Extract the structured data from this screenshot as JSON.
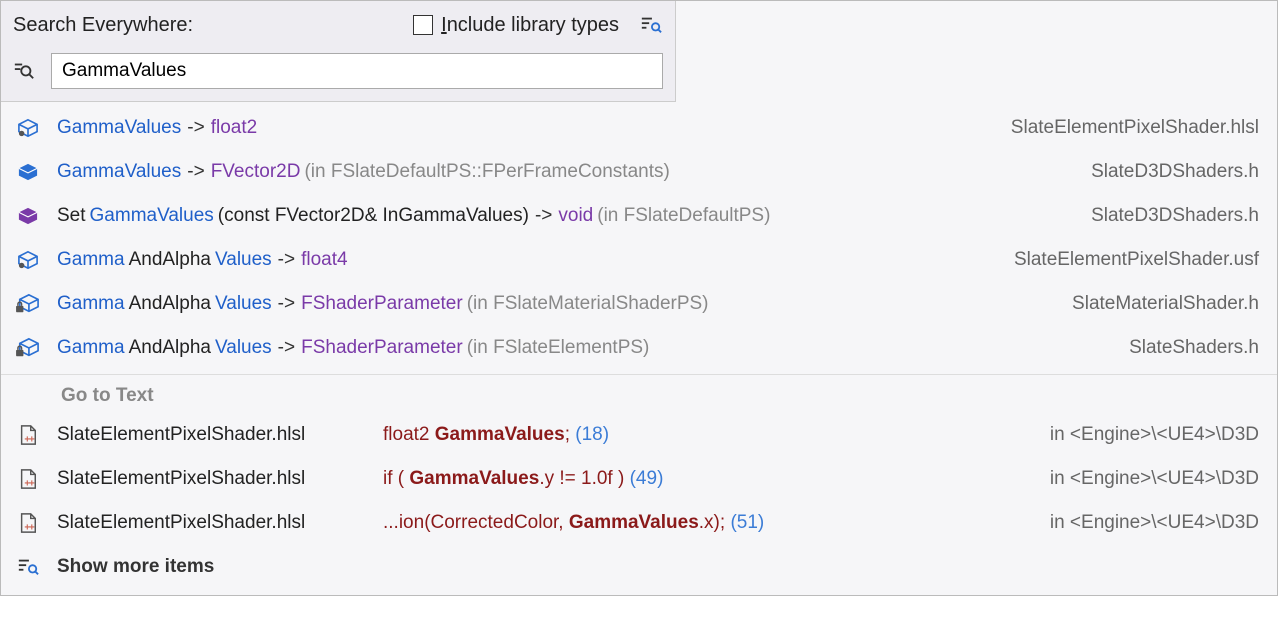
{
  "header": {
    "title": "Search Everywhere:",
    "include_library_label_pre": "I",
    "include_library_label_post": "nclude library types",
    "search_value": "GammaValues"
  },
  "symbol_results": [
    {
      "icon": "box-blue",
      "parts": [
        {
          "t": "GammaValues",
          "c": "blue"
        },
        {
          "t": " -> ",
          "c": "arrow"
        },
        {
          "t": "float2",
          "c": "purple"
        }
      ],
      "right": "SlateElementPixelShader.hlsl"
    },
    {
      "icon": "box-solid-blue",
      "parts": [
        {
          "t": "GammaValues",
          "c": "blue"
        },
        {
          "t": " -> ",
          "c": "arrow"
        },
        {
          "t": "FVector2D",
          "c": "purple"
        },
        {
          "t": " (in FSlateDefaultPS::FPerFrameConstants)",
          "c": "grey"
        }
      ],
      "right": "SlateD3DShaders.h"
    },
    {
      "icon": "box-solid-purple",
      "parts": [
        {
          "t": "Set",
          "c": "black"
        },
        {
          "t": "GammaValues",
          "c": "blue"
        },
        {
          "t": "(const FVector2D& InGammaValues)",
          "c": "black"
        },
        {
          "t": " -> ",
          "c": "arrow"
        },
        {
          "t": "void",
          "c": "purple"
        },
        {
          "t": " (in FSlateDefaultPS)",
          "c": "grey"
        }
      ],
      "right": "SlateD3DShaders.h"
    },
    {
      "icon": "box-blue",
      "parts": [
        {
          "t": "Gamma",
          "c": "blue"
        },
        {
          "t": "AndAlpha",
          "c": "black"
        },
        {
          "t": "Values",
          "c": "blue"
        },
        {
          "t": " -> ",
          "c": "arrow"
        },
        {
          "t": "float4",
          "c": "purple"
        }
      ],
      "right": "SlateElementPixelShader.usf"
    },
    {
      "icon": "box-blue-lock",
      "parts": [
        {
          "t": "Gamma",
          "c": "blue"
        },
        {
          "t": "AndAlpha",
          "c": "black"
        },
        {
          "t": "Values",
          "c": "blue"
        },
        {
          "t": " -> ",
          "c": "arrow"
        },
        {
          "t": "FShaderParameter",
          "c": "purple"
        },
        {
          "t": " (in FSlateMaterialShaderPS)",
          "c": "grey"
        }
      ],
      "right": "SlateMaterialShader.h"
    },
    {
      "icon": "box-blue-lock",
      "parts": [
        {
          "t": "Gamma",
          "c": "blue"
        },
        {
          "t": "AndAlpha",
          "c": "black"
        },
        {
          "t": "Values",
          "c": "blue"
        },
        {
          "t": " -> ",
          "c": "arrow"
        },
        {
          "t": "FShaderParameter",
          "c": "purple"
        },
        {
          "t": " (in FSlateElementPS)",
          "c": "grey"
        }
      ],
      "right": "SlateShaders.h"
    }
  ],
  "section_label": "Go to Text",
  "text_results": [
    {
      "file": "SlateElementPixelShader.hlsl",
      "snippet": [
        {
          "t": "float2 ",
          "c": "darkred"
        },
        {
          "t": "GammaValues",
          "c": "darkred bold"
        },
        {
          "t": ";",
          "c": "darkred"
        },
        {
          "t": " (18)",
          "c": "line-num"
        }
      ],
      "path": "in <Engine>\\<UE4>\\D3D"
    },
    {
      "file": "SlateElementPixelShader.hlsl",
      "snippet": [
        {
          "t": "if ( ",
          "c": "darkred"
        },
        {
          "t": "GammaValues",
          "c": "darkred bold"
        },
        {
          "t": ".y != 1.0f )",
          "c": "darkred"
        },
        {
          "t": " (49)",
          "c": "line-num"
        }
      ],
      "path": "in <Engine>\\<UE4>\\D3D"
    },
    {
      "file": "SlateElementPixelShader.hlsl",
      "snippet": [
        {
          "t": "...ion(CorrectedColor, ",
          "c": "darkred"
        },
        {
          "t": "GammaValues",
          "c": "darkred bold"
        },
        {
          "t": ".x);",
          "c": "darkred"
        },
        {
          "t": " (51)",
          "c": "line-num"
        }
      ],
      "path": "in <Engine>\\<UE4>\\D3D"
    }
  ],
  "show_more_label": "Show more items"
}
